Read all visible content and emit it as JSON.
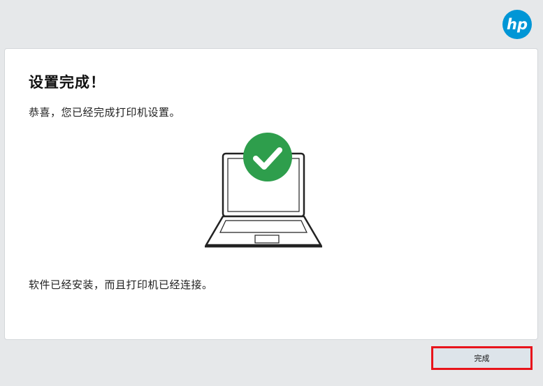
{
  "brand": {
    "logo_icon": "hp-logo-icon",
    "color": "#0096d6"
  },
  "content": {
    "title": "设置完成！",
    "subtitle": "恭喜，您已经完成打印机设置。",
    "status": "软件已经安装，而且打印机已经连接。",
    "success_color": "#2e9e4c",
    "illustration_icon": "laptop-check-icon"
  },
  "footer": {
    "finish_label": "完成"
  }
}
